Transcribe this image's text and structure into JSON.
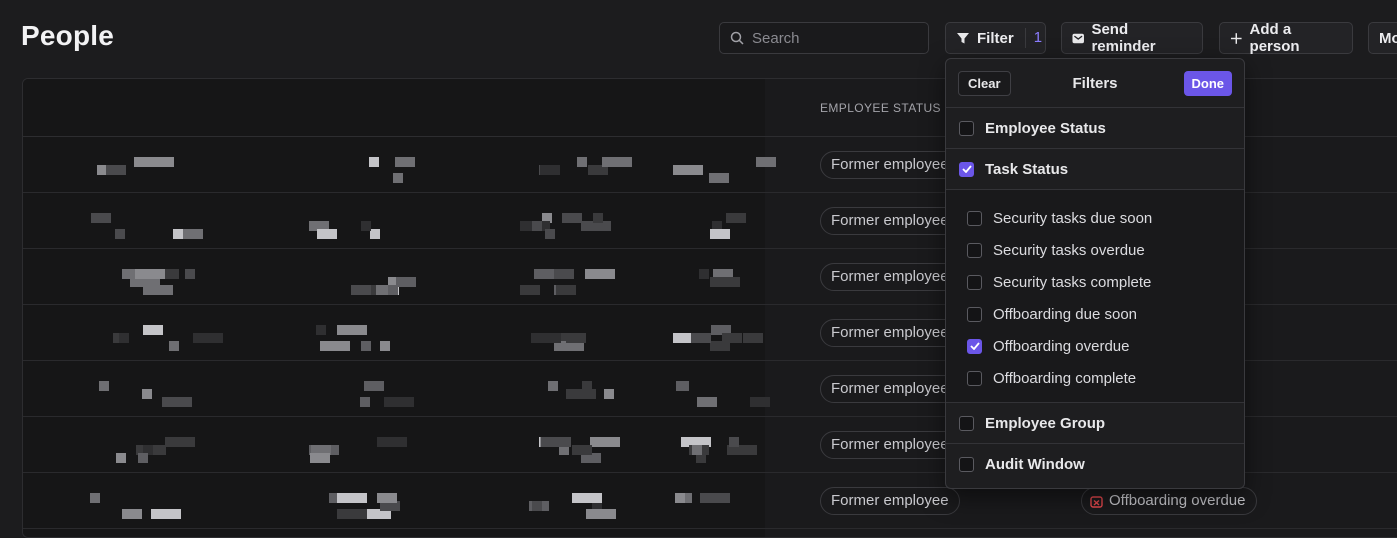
{
  "page": {
    "title": "People"
  },
  "toolbar": {
    "search_placeholder": "Search",
    "filter_label": "Filter",
    "filter_count": "1",
    "send_reminder_label": "Send reminder",
    "add_person_label": "Add a person",
    "more_label": "Mo"
  },
  "table": {
    "headers": {
      "employee_status": "EMPLOYEE STATUS"
    },
    "rows": [
      {
        "employee_status": "Former employee",
        "task_status": ""
      },
      {
        "employee_status": "Former employee",
        "task_status": ""
      },
      {
        "employee_status": "Former employee",
        "task_status": ""
      },
      {
        "employee_status": "Former employee",
        "task_status": ""
      },
      {
        "employee_status": "Former employee",
        "task_status": ""
      },
      {
        "employee_status": "Former employee",
        "task_status": ""
      },
      {
        "employee_status": "Former employee",
        "task_status": "Offboarding overdue"
      }
    ]
  },
  "filter_panel": {
    "clear_label": "Clear",
    "title": "Filters",
    "done_label": "Done",
    "sections": [
      {
        "label": "Employee Status",
        "checked": false
      },
      {
        "label": "Task Status",
        "checked": true
      },
      {
        "label": "Employee Group",
        "checked": false
      },
      {
        "label": "Audit Window",
        "checked": false
      }
    ],
    "task_status_options": [
      {
        "label": "Security tasks due soon",
        "checked": false
      },
      {
        "label": "Security tasks overdue",
        "checked": false
      },
      {
        "label": "Security tasks complete",
        "checked": false
      },
      {
        "label": "Offboarding due soon",
        "checked": false
      },
      {
        "label": "Offboarding overdue",
        "checked": true
      },
      {
        "label": "Offboarding complete",
        "checked": false
      }
    ]
  },
  "colors": {
    "accent": "#6b56e8",
    "overdue_icon": "#e5484d",
    "background": "#1c1c1e"
  }
}
